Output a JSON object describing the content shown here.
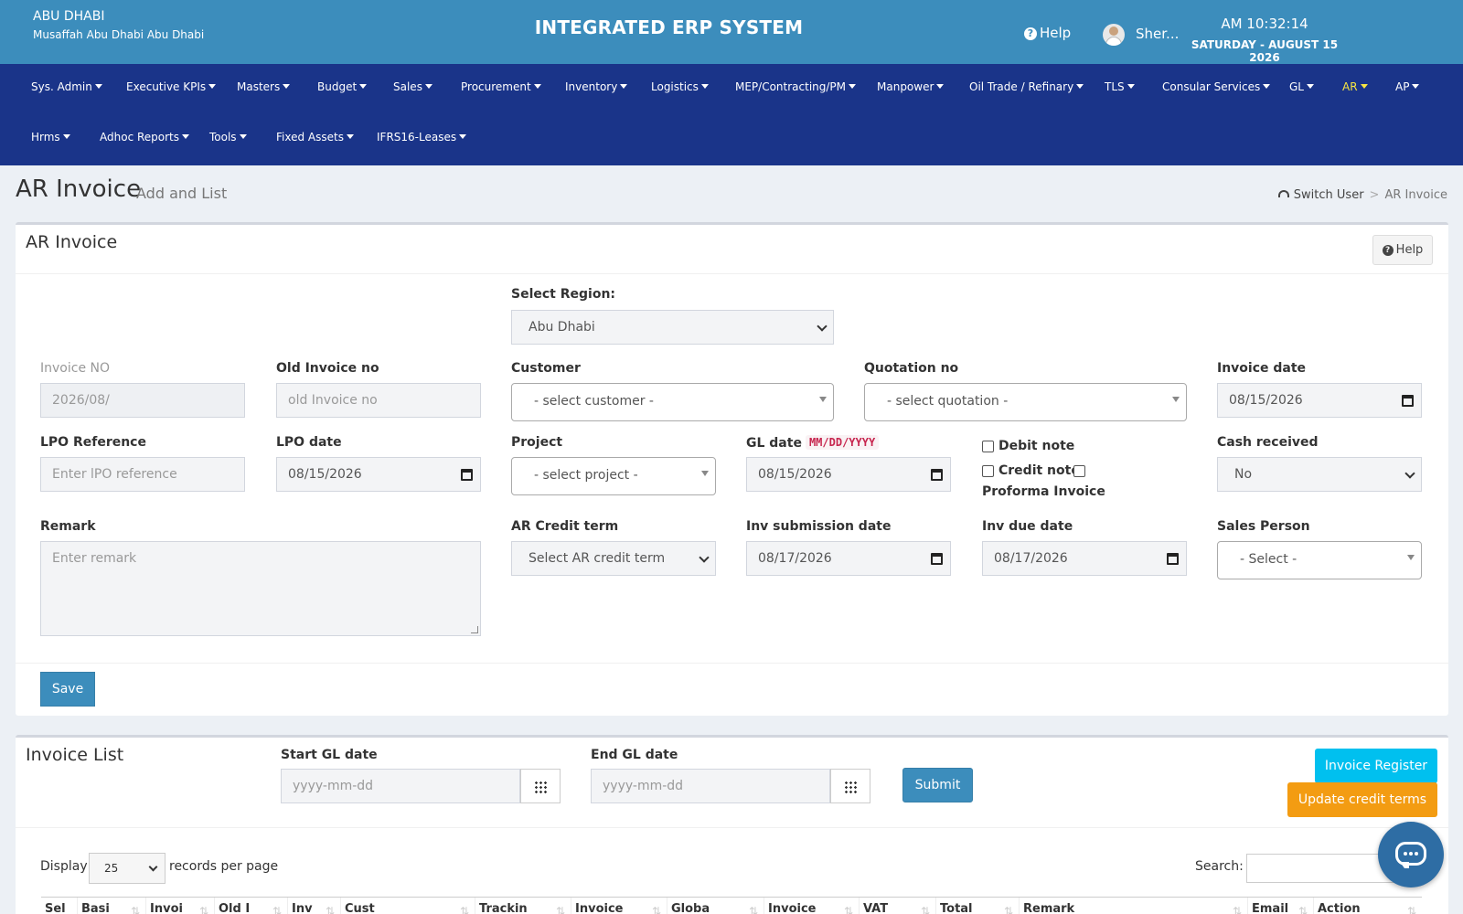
{
  "header": {
    "company_name": "ABU DHABI",
    "company_address": "Musaffah Abu Dhabi Abu Dhabi",
    "app_title": "INTEGRATED ERP SYSTEM",
    "help_label": "Help",
    "user_name": "Sher...",
    "clock": "AM 10:32:14",
    "date": "SATURDAY - AUGUST 15 2026"
  },
  "nav": {
    "row1": [
      "Sys. Admin",
      "Executive KPIs",
      "Masters",
      "Budget",
      "Sales",
      "Procurement",
      "Inventory",
      "Logistics",
      "MEP/Contracting/PM",
      "Manpower",
      "Oil Trade / Refinary",
      "TLS",
      "Consular Services",
      "GL",
      "AR",
      "AP"
    ],
    "row2": [
      "Hrms",
      "Adhoc Reports",
      "Tools",
      "Fixed Assets",
      "IFRS16-Leases"
    ],
    "active": "AR",
    "active_color": "#f7e642"
  },
  "page": {
    "title": "AR Invoice",
    "subtitle": "Add and List",
    "breadcrumb_home": "Switch User",
    "breadcrumb_current": "AR Invoice"
  },
  "form": {
    "box_title": "AR Invoice",
    "help_button": "Help",
    "region": {
      "label": "Select Region:",
      "value": "Abu Dhabi"
    },
    "invoice_no": {
      "label": "Invoice NO",
      "value": "2026/08/"
    },
    "old_invoice_no": {
      "label": "Old Invoice no",
      "placeholder": "old Invoice no"
    },
    "customer": {
      "label": "Customer",
      "value": "- select customer -"
    },
    "quotation_no": {
      "label": "Quotation no",
      "value": "- select quotation -"
    },
    "invoice_date": {
      "label": "Invoice date",
      "value": "08/15/2026"
    },
    "lpo_reference": {
      "label": "LPO Reference",
      "placeholder": "Enter lPO reference"
    },
    "lpo_date": {
      "label": "LPO date",
      "value": "08/15/2026"
    },
    "project": {
      "label": "Project",
      "value": "- select project -"
    },
    "gl_date": {
      "label": "GL date",
      "format_hint": "MM/DD/YYYY",
      "value": "08/15/2026"
    },
    "debit_note": "Debit note",
    "credit_note": "Credit note",
    "proforma_invoice": "Proforma Invoice",
    "cash_received": {
      "label": "Cash received",
      "value": "No"
    },
    "remark": {
      "label": "Remark",
      "placeholder": "Enter remark"
    },
    "ar_credit_term": {
      "label": "AR Credit term",
      "value": "Select AR credit term"
    },
    "inv_submission_date": {
      "label": "Inv submission date",
      "value": "08/17/2026"
    },
    "inv_due_date": {
      "label": "Inv due date",
      "value": "08/17/2026"
    },
    "sales_person": {
      "label": "Sales Person",
      "value": "- Select -"
    },
    "save_button": "Save"
  },
  "invoice_list": {
    "title": "Invoice List",
    "start_gl_date": {
      "label": "Start GL date",
      "placeholder": "yyyy-mm-dd"
    },
    "end_gl_date": {
      "label": "End GL date",
      "placeholder": "yyyy-mm-dd"
    },
    "submit_button": "Submit",
    "register_button": "Invoice Register",
    "update_terms_button": "Update credit terms",
    "display_label": "Display",
    "page_length": "25",
    "records_label": "records per page",
    "search_label": "Search:",
    "columns": [
      "Sel",
      "Basi",
      "Invoi",
      "Old I",
      "Inv",
      "Cust",
      "Trackin",
      "Invoice",
      "Globa",
      "Invoice",
      "VAT",
      "Total",
      "Remark",
      "Email",
      "Action"
    ]
  },
  "colors": {
    "header_bg": "#3c8dbc",
    "nav_bg": "#1a3489",
    "primary": "#3c8dbc",
    "cyan": "#00c0ef",
    "orange": "#f39c12"
  }
}
